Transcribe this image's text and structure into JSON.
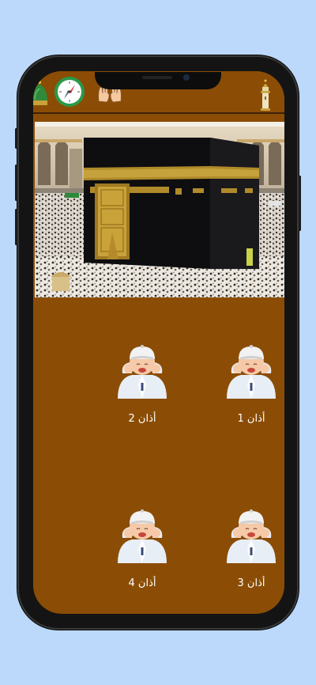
{
  "app": {
    "toolbar": {
      "icons": [
        "dome-icon",
        "compass-icon",
        "praying-hands-icon",
        "minaret-icon"
      ]
    },
    "hero": {
      "image": "kaaba-photo"
    },
    "azan_items": [
      {
        "label": "أذان 1"
      },
      {
        "label": "أذان 2"
      },
      {
        "label": "أذان 3"
      },
      {
        "label": "أذان 4"
      }
    ],
    "colors": {
      "background": "#8b4d05",
      "page_bg": "#bcd9fb",
      "divider": "#3d2003",
      "label": "#ffffff"
    }
  }
}
